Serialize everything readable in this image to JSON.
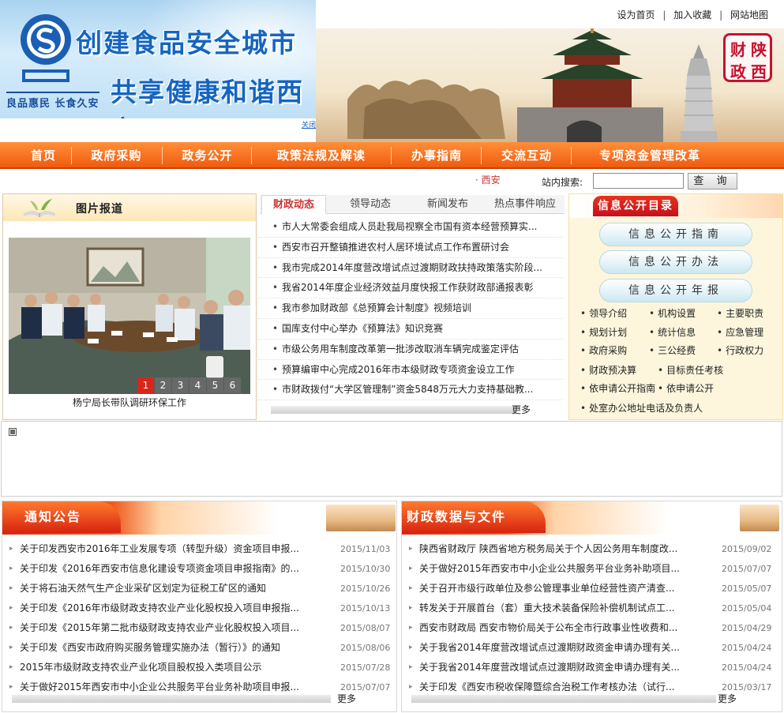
{
  "header": {
    "banner_slogan_line1": "创建食品安全城市",
    "banner_slogan_line2": "共享健康和谐西安",
    "banner_motto": "良品惠民 长食久安",
    "banner_close": "关闭",
    "top_links": [
      "设为首页",
      "加入收藏",
      "网站地图"
    ],
    "seal_chars": [
      "陕",
      "西",
      "财",
      "政"
    ]
  },
  "nav": {
    "items": [
      "首页",
      "政府采购",
      "政务公开",
      "政策法规及解读",
      "办事指南",
      "交流互动",
      "专项资金管理改革"
    ]
  },
  "search": {
    "marquee_text": "西安",
    "label": "站内搜索:",
    "input_value": "",
    "button_label": "查 询"
  },
  "photo_news": {
    "title": "图片报道",
    "caption": "杨宁局长带队调研环保工作",
    "pages": [
      "1",
      "2",
      "3",
      "4",
      "5",
      "6"
    ],
    "active_page": "1"
  },
  "news": {
    "tabs": [
      "财政动态",
      "领导动态",
      "新闻发布",
      "热点事件响应"
    ],
    "active_tab": "财政动态",
    "items": [
      "市人大常委会组成人员赴我局视察全市国有资本经营预算实...",
      "西安市召开整镇推进农村人居环境试点工作布置研讨会",
      "我市完成2014年度营改增试点过渡期财政扶持政策落实阶段...",
      "我省2014年度企业经济效益月度快报工作获财政部通报表彰",
      "我市参加财政部《总预算会计制度》视频培训",
      "国库支付中心举办《预算法》知识竞赛",
      "市级公务用车制度改革第一批涉改取消车辆完成鉴定评估",
      "预算编审中心完成2016年市本级财政专项资金设立工作",
      "市财政拨付“大学区管理制”资金5848万元大力支持基础教..."
    ],
    "more": "更多"
  },
  "info": {
    "title": "信息公开目录",
    "buttons": [
      "信息公开指南",
      "信息公开办法",
      "信息公开年报"
    ],
    "links_row1": [
      "领导介绍",
      "机构设置",
      "主要职责"
    ],
    "links_row2": [
      "规划计划",
      "统计信息",
      "应急管理"
    ],
    "links_row3": [
      "政府采购",
      "三公经费",
      "行政权力"
    ],
    "links_row4": [
      "财政预决算",
      "目标责任考核"
    ],
    "links_row5": [
      "依申请公开指南",
      "依申请公开"
    ],
    "links_row6": [
      "处室办公地址电话及负责人"
    ]
  },
  "notices": {
    "title": "通知公告",
    "items": [
      {
        "title": "关于印发西安市2016年工业发展专项（转型升级）资金项目申报...",
        "date": "2015/11/03"
      },
      {
        "title": "关于印发《2016年西安市信息化建设专项资金项目申报指南》的...",
        "date": "2015/10/30"
      },
      {
        "title": "关于将石油天然气生产企业采矿区划定为征税工矿区的通知",
        "date": "2015/10/26"
      },
      {
        "title": "关于印发《2016年市级财政支持农业产业化股权投入项目申报指...",
        "date": "2015/10/13"
      },
      {
        "title": "关于印发《2015年第二批市级财政支持农业产业化股权投入项目...",
        "date": "2015/08/07"
      },
      {
        "title": "关于印发《西安市政府购买服务管理实施办法（暂行）》的通知",
        "date": "2015/08/06"
      },
      {
        "title": "2015年市级财政支持农业产业化项目股权投入类项目公示",
        "date": "2015/07/28"
      },
      {
        "title": "关于做好2015年西安市中小企业公共服务平台业务补助项目申报...",
        "date": "2015/07/07"
      }
    ],
    "more": "更多"
  },
  "finance_docs": {
    "title": "财政数据与文件",
    "items": [
      {
        "title": "陕西省财政厅 陕西省地方税务局关于个人因公务用车制度改...",
        "date": "2015/09/02"
      },
      {
        "title": "关于做好2015年西安市中小企业公共服务平台业务补助项目...",
        "date": "2015/07/07"
      },
      {
        "title": "关于召开市级行政单位及参公管理事业单位经营性资产清查...",
        "date": "2015/05/07"
      },
      {
        "title": "转发关于开展首台（套）重大技术装备保险补偿机制试点工...",
        "date": "2015/05/04"
      },
      {
        "title": "西安市财政局 西安市物价局关于公布全市行政事业性收费和...",
        "date": "2015/04/29"
      },
      {
        "title": "关于我省2014年度营改增试点过渡期财政资金申请办理有关...",
        "date": "2015/04/24"
      },
      {
        "title": "关于我省2014年度营改增试点过渡期财政资金申请办理有关...",
        "date": "2015/04/24"
      },
      {
        "title": "关于印发《西安市税收保障暨综合治税工作考核办法（试行...",
        "date": "2015/03/17"
      }
    ],
    "more": "更多"
  },
  "colors": {
    "nav_orange": "#f05b0e",
    "title_red": "#c8101e",
    "link_blue": "#1e5fbf",
    "info_bg": "#fdf6dd"
  }
}
